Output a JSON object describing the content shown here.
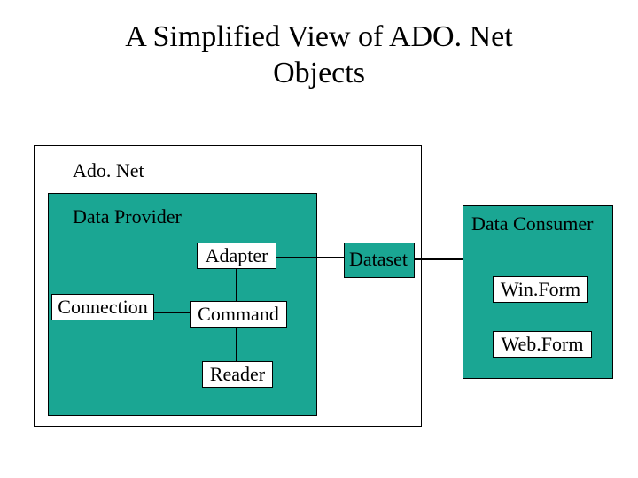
{
  "title_line1": "A Simplified View of ADO. Net",
  "title_line2": "Objects",
  "labels": {
    "adonet": "Ado. Net",
    "data_provider": "Data Provider",
    "data_consumer": "Data Consumer"
  },
  "nodes": {
    "adapter": "Adapter",
    "connection": "Connection",
    "command": "Command",
    "reader": "Reader",
    "dataset": "Dataset",
    "winform": "Win.Form",
    "webform": "Web.Form"
  }
}
